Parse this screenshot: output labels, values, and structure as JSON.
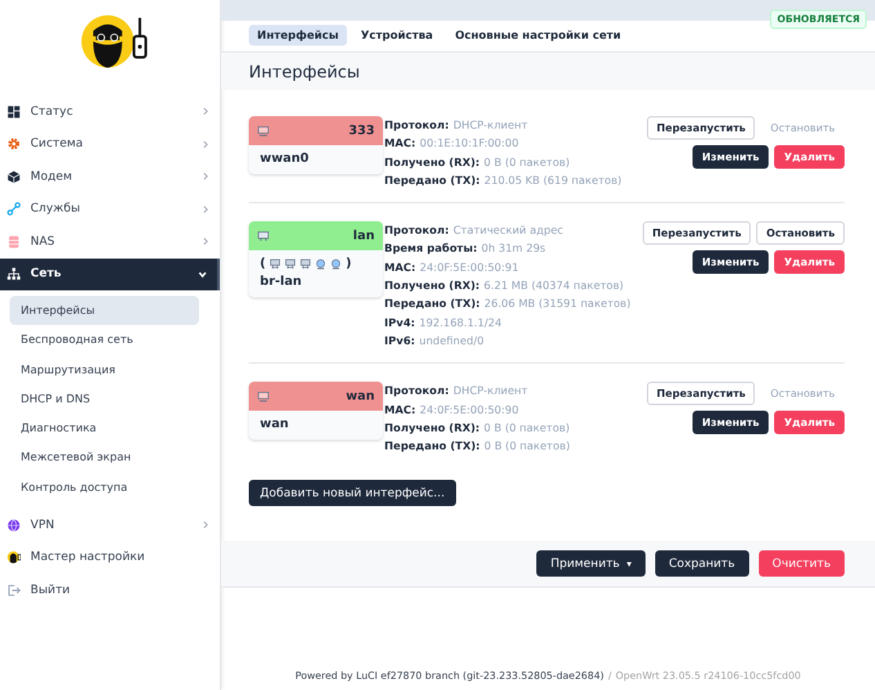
{
  "sidebar": {
    "items": [
      {
        "label": "Статус",
        "expanded": false,
        "has_children": true
      },
      {
        "label": "Система",
        "expanded": false,
        "has_children": true
      },
      {
        "label": "Модем",
        "expanded": false,
        "has_children": true
      },
      {
        "label": "Службы",
        "expanded": false,
        "has_children": true
      },
      {
        "label": "NAS",
        "expanded": false,
        "has_children": true
      },
      {
        "label": "Сеть",
        "expanded": true,
        "has_children": true,
        "children": [
          {
            "label": "Интерфейсы",
            "selected": true
          },
          {
            "label": "Беспроводная сеть",
            "selected": false
          },
          {
            "label": "Маршрутизация",
            "selected": false
          },
          {
            "label": "DHCP и DNS",
            "selected": false
          },
          {
            "label": "Диагностика",
            "selected": false
          },
          {
            "label": "Межсетевой экран",
            "selected": false
          },
          {
            "label": "Контроль доступа",
            "selected": false
          }
        ]
      },
      {
        "label": "VPN",
        "expanded": false,
        "has_children": true
      },
      {
        "label": "Мастер настройки",
        "expanded": false,
        "has_children": false
      },
      {
        "label": "Выйти",
        "expanded": false,
        "has_children": false
      }
    ]
  },
  "badge": "ОБНОВЛЯЕТСЯ",
  "tabs": [
    {
      "label": "Интерфейсы",
      "selected": true
    },
    {
      "label": "Устройства",
      "selected": false
    },
    {
      "label": "Основные настройки сети",
      "selected": false
    }
  ],
  "section_title": "Интерфейсы",
  "interfaces": [
    {
      "name": "333",
      "up": false,
      "device": "wwan0",
      "fields": [
        {
          "label": "Протокол:",
          "value": "DHCP-клиент"
        },
        {
          "label": "MAC:",
          "value": "00:1E:10:1F:00:00"
        },
        {
          "label": "Получено (RX):",
          "value": "0 B (0 пакетов)"
        },
        {
          "label": "Передано (TX):",
          "value": "210.05 KB (619 пакетов)"
        }
      ],
      "buttons": {
        "restart": {
          "label": "Перезапустить",
          "disabled": false
        },
        "stop": {
          "label": "Остановить",
          "disabled": true
        },
        "edit": {
          "label": "Изменить"
        },
        "delete": {
          "label": "Удалить"
        }
      }
    },
    {
      "name": "lan",
      "up": true,
      "device": "br-lan",
      "ports_open": "(",
      "ports_close": ")",
      "ports": [
        {
          "kind": "ethernet"
        },
        {
          "kind": "ethernet"
        },
        {
          "kind": "ethernet"
        },
        {
          "kind": "wireless"
        },
        {
          "kind": "wireless"
        }
      ],
      "fields": [
        {
          "label": "Протокол:",
          "value": "Статический адрес"
        },
        {
          "label": "Время работы:",
          "value": "0h 31m 29s"
        },
        {
          "label": "MAC:",
          "value": "24:0F:5E:00:50:91"
        },
        {
          "label": "Получено (RX):",
          "value": "6.21 MB (40374 пакетов)"
        },
        {
          "label": "Передано (TX):",
          "value": "26.06 MB (31591 пакетов)"
        },
        {
          "label": "IPv4:",
          "value": "192.168.1.1/24"
        },
        {
          "label": "IPv6:",
          "value": "undefined/0"
        }
      ],
      "buttons": {
        "restart": {
          "label": "Перезапустить",
          "disabled": false
        },
        "stop": {
          "label": "Остановить",
          "disabled": false
        },
        "edit": {
          "label": "Изменить"
        },
        "delete": {
          "label": "Удалить"
        }
      }
    },
    {
      "name": "wan",
      "up": false,
      "device": "wan",
      "fields": [
        {
          "label": "Протокол:",
          "value": "DHCP-клиент"
        },
        {
          "label": "MAC:",
          "value": "24:0F:5E:00:50:90"
        },
        {
          "label": "Получено (RX):",
          "value": "0 B (0 пакетов)"
        },
        {
          "label": "Передано (TX):",
          "value": "0 B (0 пакетов)"
        }
      ],
      "buttons": {
        "restart": {
          "label": "Перезапустить",
          "disabled": false
        },
        "stop": {
          "label": "Остановить",
          "disabled": true
        },
        "edit": {
          "label": "Изменить"
        },
        "delete": {
          "label": "Удалить"
        }
      }
    }
  ],
  "add_button": "Добавить новый интерфейс...",
  "actions": {
    "apply": "Применить",
    "apply_caret": "▾",
    "save": "Сохранить",
    "reset": "Очистить"
  },
  "footer": {
    "powered": "Powered by LuCI ef27870 branch (git-23.233.52805-dae2684)",
    "separator": "/",
    "version": "OpenWrt 23.05.5 r24106-10cc5fcd00"
  }
}
